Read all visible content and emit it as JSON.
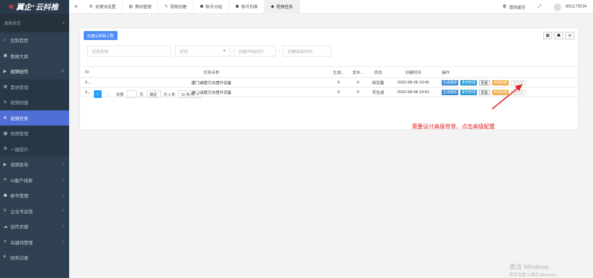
{
  "sidebar": {
    "logo_mark": "❀",
    "logo_text": "翼企⁺云抖推",
    "search_placeholder": "搜索菜单",
    "items": [
      {
        "icon": "dashboard-icon",
        "glyph": "⌂",
        "label": "控制首页",
        "type": "top",
        "chevron": ""
      },
      {
        "icon": "bigscreen-icon",
        "glyph": "▣",
        "label": "数据大屏",
        "type": "top",
        "chevron": ""
      },
      {
        "icon": "video-create-icon",
        "glyph": "▶",
        "label": "视频创作",
        "type": "open",
        "chevron": "∨"
      },
      {
        "icon": "image-icon",
        "glyph": "▤",
        "label": "素材管理",
        "type": "sub",
        "chevron": ""
      },
      {
        "icon": "edit-icon",
        "glyph": "✎",
        "label": "视频创建",
        "type": "sub",
        "chevron": ""
      },
      {
        "icon": "tag-icon",
        "glyph": "◆",
        "label": "视频任务",
        "type": "active",
        "chevron": ""
      },
      {
        "icon": "film-icon",
        "glyph": "▦",
        "label": "视频管理",
        "type": "sub",
        "chevron": ""
      },
      {
        "icon": "gear-icon",
        "glyph": "⚙",
        "label": "一键成片",
        "type": "sub",
        "chevron": ""
      },
      {
        "icon": "publish-icon",
        "glyph": "▶",
        "label": "视频发布",
        "type": "top",
        "chevron": "‹"
      },
      {
        "icon": "ai-icon",
        "glyph": "✈",
        "label": "AI客户线索",
        "type": "top",
        "chevron": "‹"
      },
      {
        "icon": "users-icon",
        "glyph": "☗",
        "label": "帐号管理",
        "type": "top",
        "chevron": "‹"
      },
      {
        "icon": "enterprise-icon",
        "glyph": "V",
        "label": "企业号运营",
        "type": "top",
        "chevron": "‹"
      },
      {
        "icon": "idea-icon",
        "glyph": "☁",
        "label": "创作灵感",
        "type": "top",
        "chevron": "‹"
      },
      {
        "icon": "keyword-icon",
        "glyph": "✎",
        "label": "关键词管理",
        "type": "top",
        "chevron": "‹"
      },
      {
        "icon": "finance-icon",
        "glyph": "¥",
        "label": "财务记录",
        "type": "top",
        "chevron": ""
      }
    ]
  },
  "topbar": {
    "menu_glyph": "≡",
    "tabs": [
      {
        "icon": "gear-icon",
        "glyph": "⚙",
        "label": "关键词设置",
        "active": false
      },
      {
        "icon": "image-icon",
        "glyph": "▨",
        "label": "素材管理",
        "active": false
      },
      {
        "icon": "edit-icon",
        "glyph": "✎",
        "label": "视频创建",
        "active": false
      },
      {
        "icon": "user-icon",
        "glyph": "☗",
        "label": "帐号分组",
        "active": false
      },
      {
        "icon": "user-icon",
        "glyph": "☗",
        "label": "帐号列表",
        "active": false
      },
      {
        "icon": "tag-icon",
        "glyph": "◆",
        "label": "视频任务",
        "active": true
      }
    ],
    "clear_cache_glyph": "🗑",
    "clear_cache": "清除缓存",
    "fullscreen_glyph": "⤢",
    "username": "i851179534"
  },
  "panel": {
    "create_button": "创建云剪辑工程",
    "tool_glyphs": [
      "▦",
      "☗",
      "⊖"
    ],
    "filters": {
      "task_name_placeholder": "任务名称",
      "status_placeholder": "状态",
      "start_time_placeholder": "创建开始时间",
      "separator": "-",
      "end_time_placeholder": "创建结束时间"
    },
    "columns": [
      "ID",
      "任务名称",
      "生成...",
      "发布...",
      "状态",
      "创建时间",
      "操作"
    ],
    "rows": [
      {
        "id": "2...",
        "name": "厦门诚煜污水提升设备",
        "generated": "0",
        "published": "0",
        "status": "待完善",
        "created": "2022-08-09 10:45"
      },
      {
        "id": "2...",
        "name": "厦门诚煜污水提升设备",
        "generated": "0",
        "published": "0",
        "status": "可生成",
        "created": "2022-08-08 19:41"
      }
    ],
    "actions": {
      "generate": "生成视频",
      "materials": "素材管理",
      "config": "配置",
      "advanced": "高级配置",
      "timer": "定时发"
    },
    "pager": {
      "prev": "‹",
      "current_page": "1",
      "next": "›",
      "goto_label": "到第",
      "page_unit": "页",
      "confirm": "确定",
      "total": "共 2 条",
      "page_size": "10 条/页"
    }
  },
  "annotation": "需要设计高级背景，点击高级配置",
  "watermark": {
    "line1": "激活 Windows",
    "line2": "转到\"设置\"以激活 Windows。"
  },
  "colors": {
    "sidebar_bg": "#2f4050",
    "active_menu": "#4f6ed6",
    "primary_blue": "#4e8bf6",
    "advanced_orange": "#f0ad4e",
    "annotation_red": "#e02020"
  }
}
